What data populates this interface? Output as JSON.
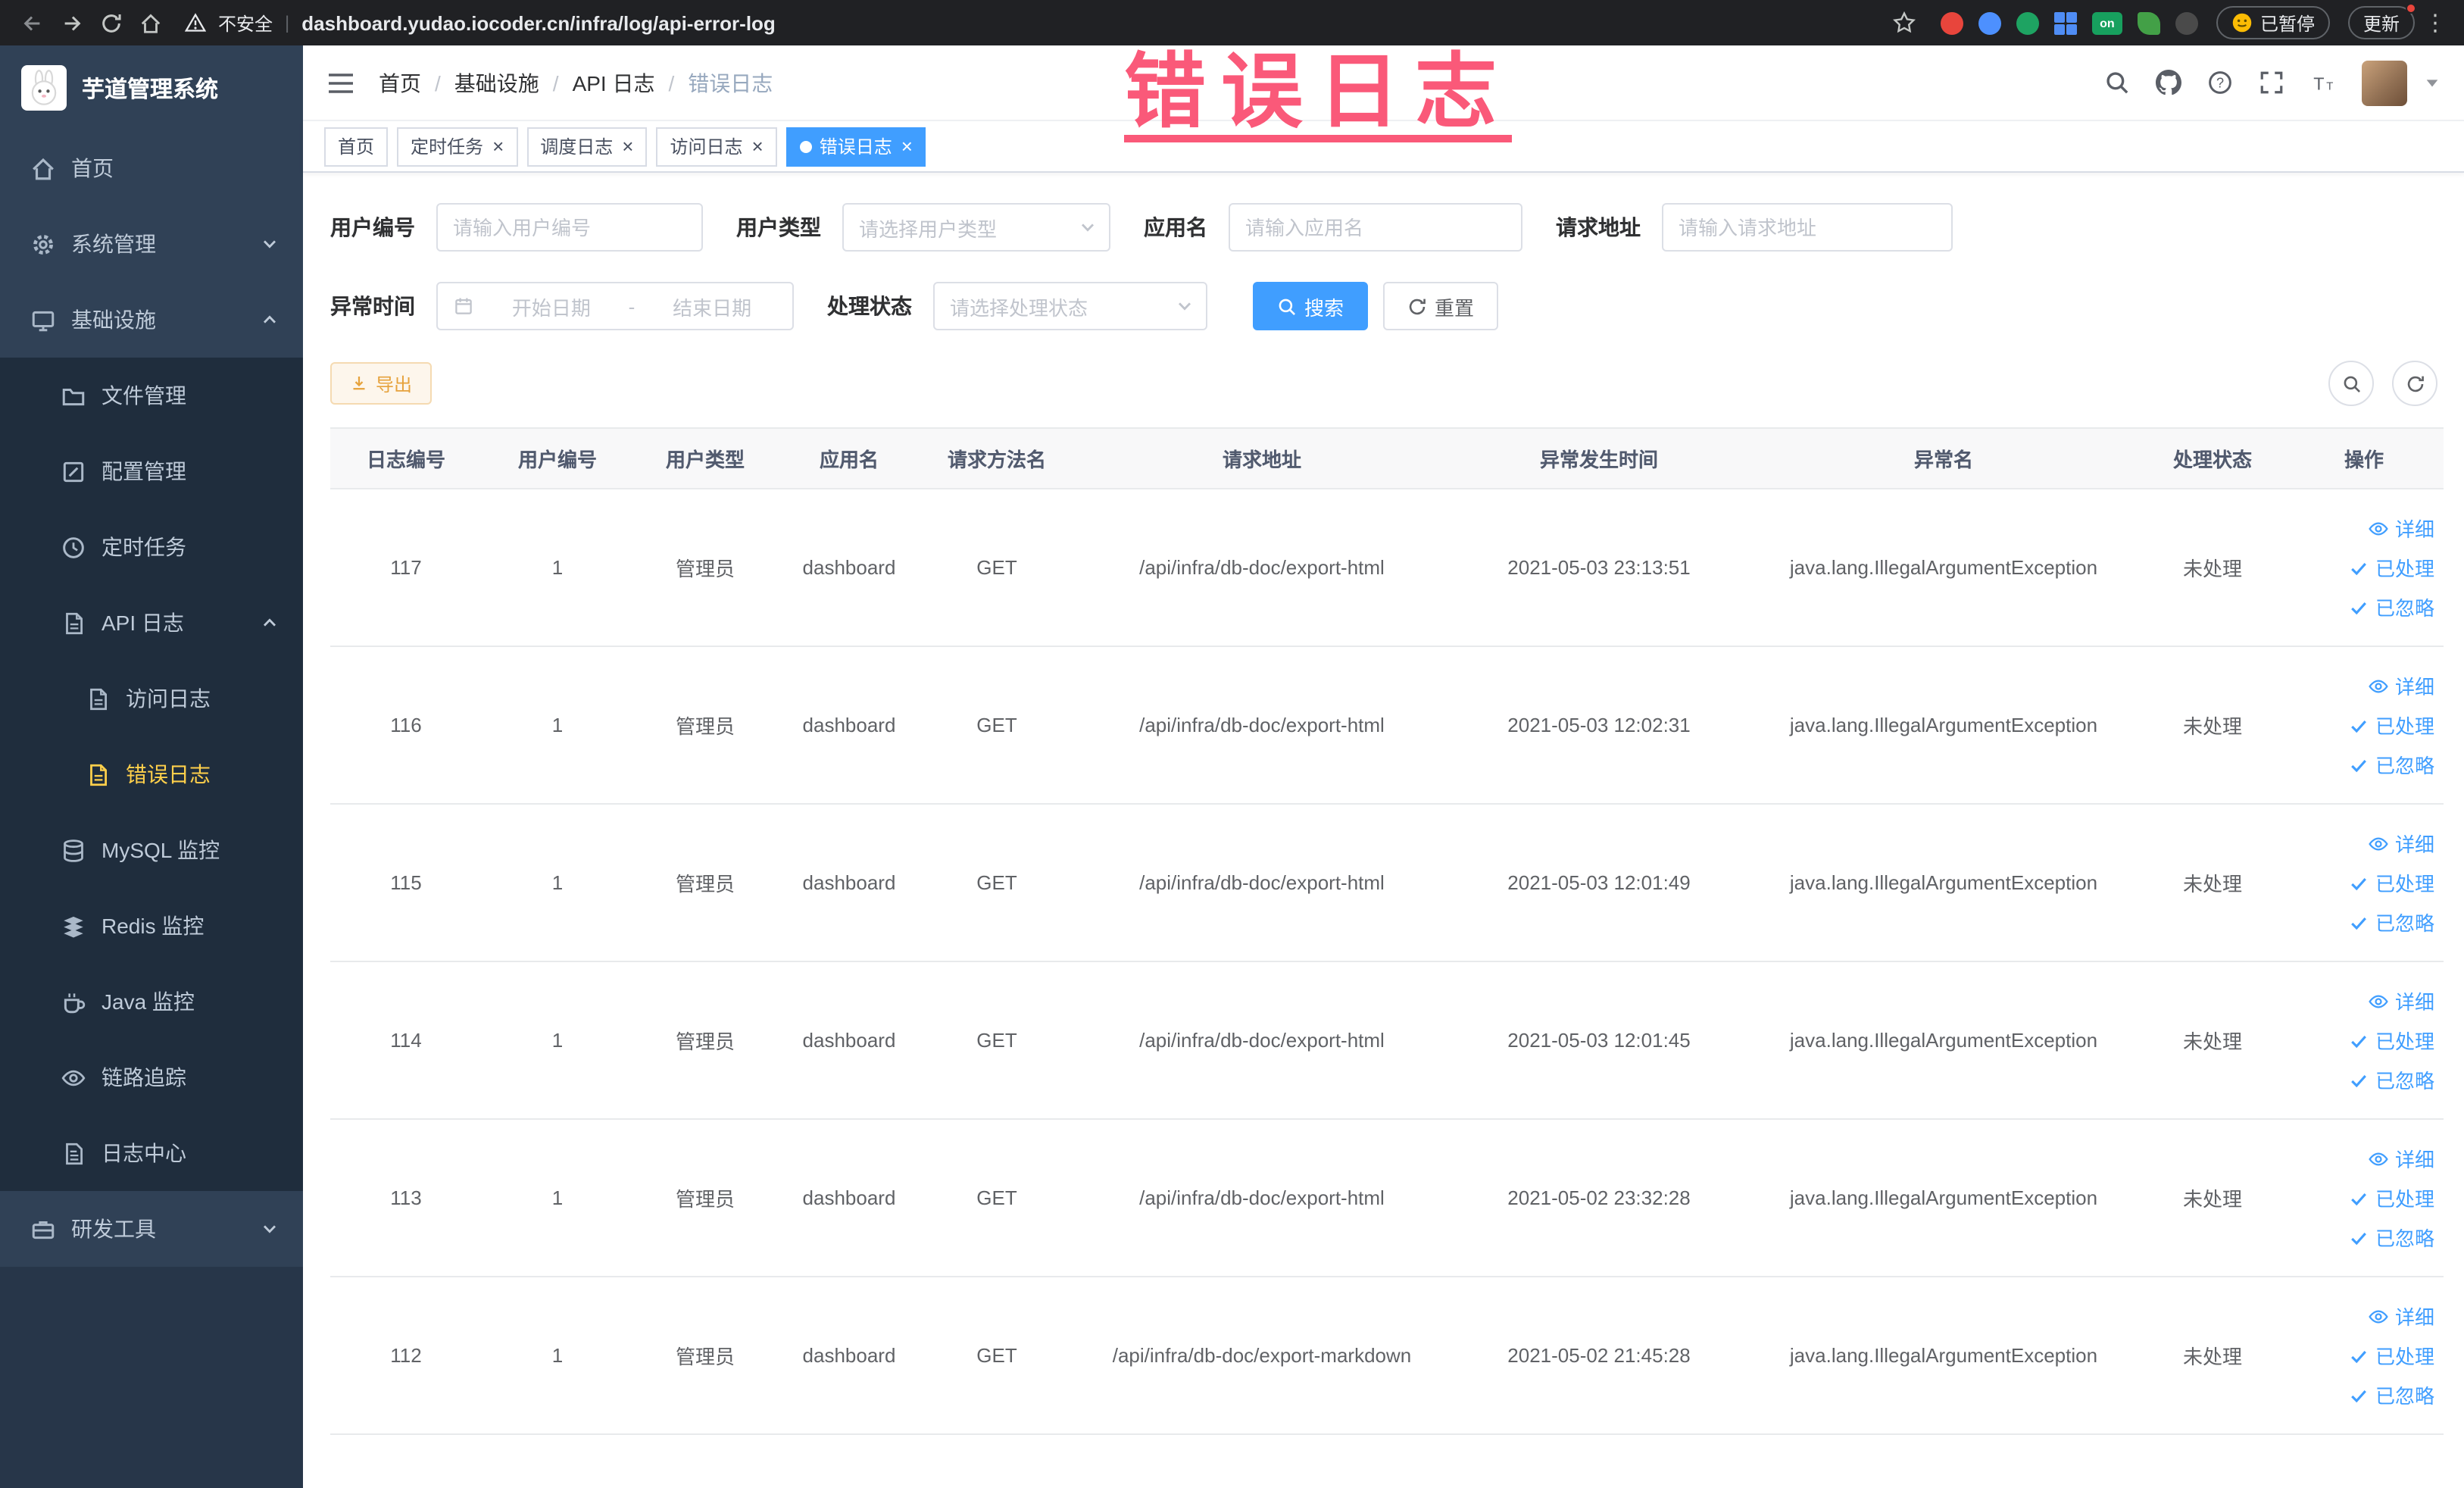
{
  "browser": {
    "security_label": "不安全",
    "url": "dashboard.yudao.iocoder.cn/infra/log/api-error-log",
    "paused_label": "已暂停",
    "update_label": "更新",
    "extensions": [
      {
        "name": "extension-icon-1",
        "color": "#e8453c",
        "shape": "circle"
      },
      {
        "name": "extension-icon-2",
        "color": "#4d90fe",
        "shape": "circle"
      },
      {
        "name": "extension-icon-3",
        "color": "#1ea362",
        "shape": "circle"
      },
      {
        "name": "extension-icon-4",
        "color": "#4f8df5",
        "shape": "grid"
      },
      {
        "name": "extension-icon-on",
        "color": "#17a05e",
        "shape": "badge",
        "label": "on"
      },
      {
        "name": "extension-icon-6",
        "color": "#43a047",
        "shape": "leaf"
      },
      {
        "name": "extension-icon-7",
        "color": "#4a4a4a",
        "shape": "circle"
      }
    ]
  },
  "sidebar": {
    "logo_title": "芋道管理系统",
    "items": [
      {
        "key": "home",
        "label": "首页",
        "icon": "home-icon",
        "level": 1
      },
      {
        "key": "system",
        "label": "系统管理",
        "icon": "gear-icon",
        "level": 1,
        "arrow": "down"
      },
      {
        "key": "infra",
        "label": "基础设施",
        "icon": "monitor-icon",
        "level": 1,
        "arrow": "up"
      },
      {
        "key": "file",
        "label": "文件管理",
        "icon": "folder-icon",
        "level": 2,
        "sub": true
      },
      {
        "key": "config",
        "label": "配置管理",
        "icon": "edit-icon",
        "level": 2,
        "sub": true
      },
      {
        "key": "job",
        "label": "定时任务",
        "icon": "clock-icon",
        "level": 2,
        "sub": true
      },
      {
        "key": "api-log",
        "label": "API 日志",
        "icon": "document-icon",
        "level": 2,
        "sub": true,
        "arrow": "up"
      },
      {
        "key": "access-log",
        "label": "访问日志",
        "icon": "document-icon",
        "level": 3,
        "sub": true
      },
      {
        "key": "error-log",
        "label": "错误日志",
        "icon": "document-icon",
        "level": 3,
        "sub": true,
        "active": true
      },
      {
        "key": "mysql",
        "label": "MySQL 监控",
        "icon": "database-icon",
        "level": 2,
        "sub": true
      },
      {
        "key": "redis",
        "label": "Redis 监控",
        "icon": "redis-icon",
        "level": 2,
        "sub": true
      },
      {
        "key": "java",
        "label": "Java 监控",
        "icon": "coffee-icon",
        "level": 2,
        "sub": true
      },
      {
        "key": "trace",
        "label": "链路追踪",
        "icon": "eye-icon",
        "level": 2,
        "sub": true
      },
      {
        "key": "log-center",
        "label": "日志中心",
        "icon": "log-icon",
        "level": 2,
        "sub": true
      },
      {
        "key": "dev-tools",
        "label": "研发工具",
        "icon": "toolbox-icon",
        "level": 1,
        "arrow": "down"
      }
    ]
  },
  "header": {
    "breadcrumb": [
      {
        "label": "首页",
        "current": false
      },
      {
        "label": "基础设施",
        "current": false
      },
      {
        "label": "API 日志",
        "current": false
      },
      {
        "label": "错误日志",
        "current": true
      }
    ],
    "breadcrumb_separator": "/"
  },
  "annotation": {
    "watermark": "错误日志"
  },
  "tabs": [
    {
      "key": "home",
      "label": "首页",
      "closable": false,
      "active": false
    },
    {
      "key": "job",
      "label": "定时任务",
      "closable": true,
      "active": false
    },
    {
      "key": "job-log",
      "label": "调度日志",
      "closable": true,
      "active": false
    },
    {
      "key": "access-log",
      "label": "访问日志",
      "closable": true,
      "active": false
    },
    {
      "key": "error-log",
      "label": "错误日志",
      "closable": true,
      "active": true
    }
  ],
  "filters": {
    "user_id_label": "用户编号",
    "user_id_placeholder": "请输入用户编号",
    "user_type_label": "用户类型",
    "user_type_placeholder": "请选择用户类型",
    "app_name_label": "应用名",
    "app_name_placeholder": "请输入应用名",
    "request_url_label": "请求地址",
    "request_url_placeholder": "请输入请求地址",
    "exception_time_label": "异常时间",
    "date_start_placeholder": "开始日期",
    "date_end_placeholder": "结束日期",
    "date_separator": "-",
    "process_status_label": "处理状态",
    "process_status_placeholder": "请选择处理状态",
    "search_label": "搜索",
    "reset_label": "重置"
  },
  "toolbar": {
    "export_label": "导出"
  },
  "table": {
    "headers": [
      "日志编号",
      "用户编号",
      "用户类型",
      "应用名",
      "请求方法名",
      "请求地址",
      "异常发生时间",
      "异常名",
      "处理状态",
      "操作"
    ],
    "action_labels": {
      "detail": "详细",
      "processed": "已处理",
      "ignored": "已忽略"
    },
    "rows": [
      {
        "id": "117",
        "user_id": "1",
        "user_type": "管理员",
        "app": "dashboard",
        "method": "GET",
        "url": "/api/infra/db-doc/export-html",
        "time": "2021-05-03 23:13:51",
        "exception": "java.lang.IllegalArgumentException",
        "status": "未处理"
      },
      {
        "id": "116",
        "user_id": "1",
        "user_type": "管理员",
        "app": "dashboard",
        "method": "GET",
        "url": "/api/infra/db-doc/export-html",
        "time": "2021-05-03 12:02:31",
        "exception": "java.lang.IllegalArgumentException",
        "status": "未处理"
      },
      {
        "id": "115",
        "user_id": "1",
        "user_type": "管理员",
        "app": "dashboard",
        "method": "GET",
        "url": "/api/infra/db-doc/export-html",
        "time": "2021-05-03 12:01:49",
        "exception": "java.lang.IllegalArgumentException",
        "status": "未处理"
      },
      {
        "id": "114",
        "user_id": "1",
        "user_type": "管理员",
        "app": "dashboard",
        "method": "GET",
        "url": "/api/infra/db-doc/export-html",
        "time": "2021-05-03 12:01:45",
        "exception": "java.lang.IllegalArgumentException",
        "status": "未处理"
      },
      {
        "id": "113",
        "user_id": "1",
        "user_type": "管理员",
        "app": "dashboard",
        "method": "GET",
        "url": "/api/infra/db-doc/export-html",
        "time": "2021-05-02 23:32:28",
        "exception": "java.lang.IllegalArgumentException",
        "status": "未处理"
      },
      {
        "id": "112",
        "user_id": "1",
        "user_type": "管理员",
        "app": "dashboard",
        "method": "GET",
        "url": "/api/infra/db-doc/export-markdown",
        "time": "2021-05-02 21:45:28",
        "exception": "java.lang.IllegalArgumentException",
        "status": "未处理"
      }
    ]
  },
  "colors": {
    "primary": "#409eff",
    "sidebar_bg": "#304156",
    "submenu_bg": "#1f2d3d",
    "active_menu": "#ffd04b",
    "warning": "#e6a23c",
    "annotation": "#fa4b6e"
  }
}
